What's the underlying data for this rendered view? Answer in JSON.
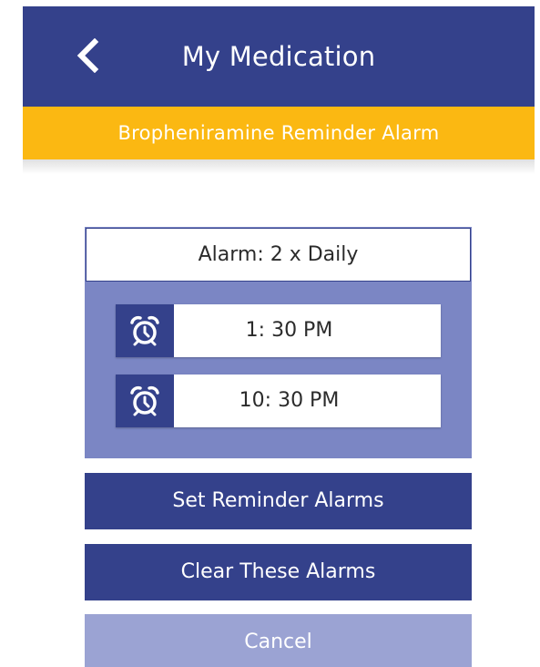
{
  "header": {
    "title": "My Medication",
    "back_icon": "chevron-left-icon"
  },
  "subheader": {
    "title": "Bropheniramine Reminder Alarm"
  },
  "alarm_panel": {
    "heading": "Alarm: 2 x Daily",
    "alarms": [
      {
        "time": "1: 30 PM",
        "icon": "alarm-clock-icon"
      },
      {
        "time": "10: 30 PM",
        "icon": "alarm-clock-icon"
      }
    ]
  },
  "actions": {
    "set_label": "Set Reminder Alarms",
    "clear_label": "Clear These Alarms",
    "cancel_label": "Cancel"
  },
  "colors": {
    "primary": "#34418b",
    "accent": "#fbb812",
    "panel": "#7b86c4",
    "cancel": "#9ba3d3"
  }
}
